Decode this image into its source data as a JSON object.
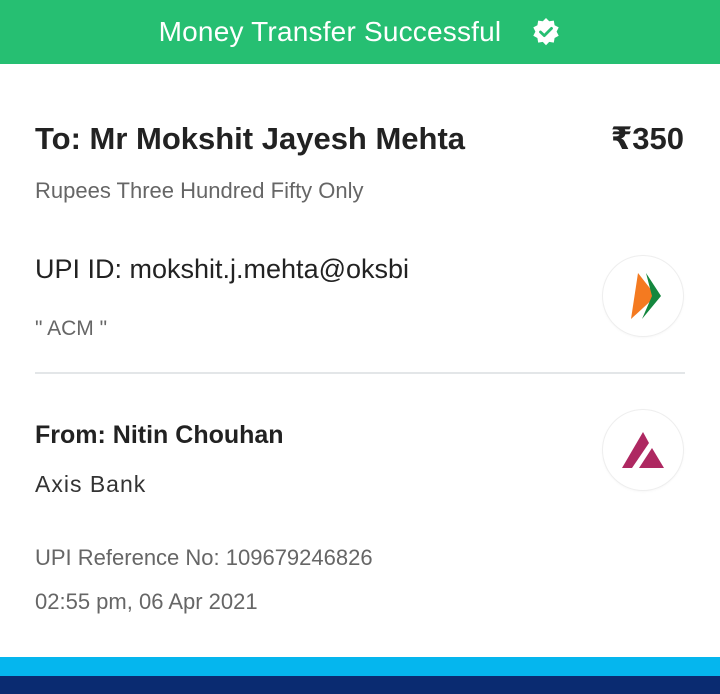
{
  "banner": {
    "title": "Money Transfer Successful",
    "icon": "verified-check-icon",
    "color": "#26bf72"
  },
  "payee": {
    "to_label": "To: Mr Mokshit Jayesh Mehta",
    "amount": "₹350",
    "amount_words": "Rupees Three Hundred Fifty Only",
    "upi_id": "UPI ID: mokshit.j.mehta@oksbi",
    "note": "\" ACM \"",
    "logo": "upi-logo-icon"
  },
  "payer": {
    "from_label": "From: Nitin Chouhan",
    "bank": "Axis Bank",
    "logo": "axis-bank-logo-icon"
  },
  "transaction": {
    "reference": "UPI Reference No: 109679246826",
    "datetime": "02:55 pm, 06 Apr 2021"
  },
  "colors": {
    "footer_light": "#05b6ee",
    "footer_dark": "#0a2b71",
    "axis_brand": "#ae2861"
  }
}
